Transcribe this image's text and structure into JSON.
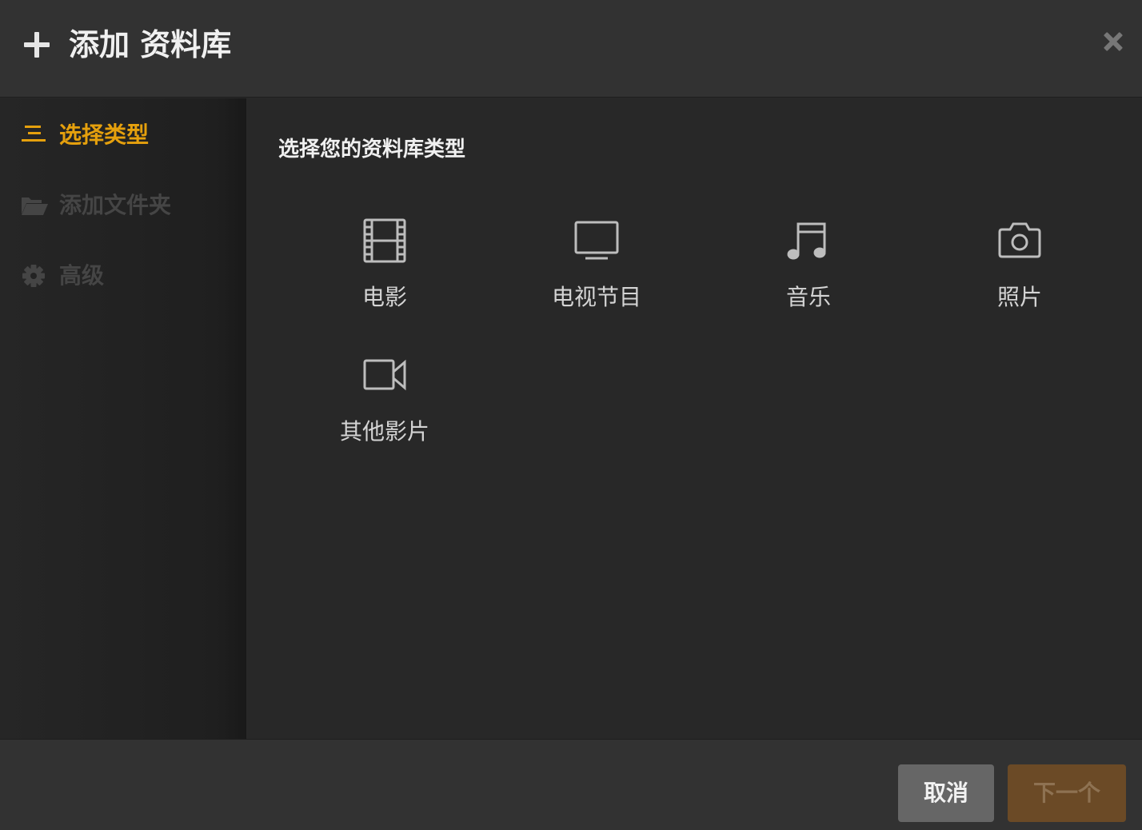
{
  "dialog": {
    "title": "添加 资料库"
  },
  "sidebar": {
    "items": [
      {
        "label": "选择类型",
        "icon": "list-icon",
        "state": "active"
      },
      {
        "label": "添加文件夹",
        "icon": "folder-open-icon",
        "state": "disabled"
      },
      {
        "label": "高级",
        "icon": "gear-icon",
        "state": "disabled"
      }
    ]
  },
  "main": {
    "heading": "选择您的资料库类型",
    "types": [
      {
        "label": "电影",
        "icon": "film-icon"
      },
      {
        "label": "电视节目",
        "icon": "tv-icon"
      },
      {
        "label": "音乐",
        "icon": "music-note-icon"
      },
      {
        "label": "照片",
        "icon": "camera-icon"
      },
      {
        "label": "其他影片",
        "icon": "video-camera-icon"
      }
    ]
  },
  "footer": {
    "cancel_label": "取消",
    "next_label": "下一个"
  },
  "colors": {
    "accent": "#e5a00d",
    "next_button_bg": "#6b4a26",
    "cancel_button_bg": "#666666"
  }
}
